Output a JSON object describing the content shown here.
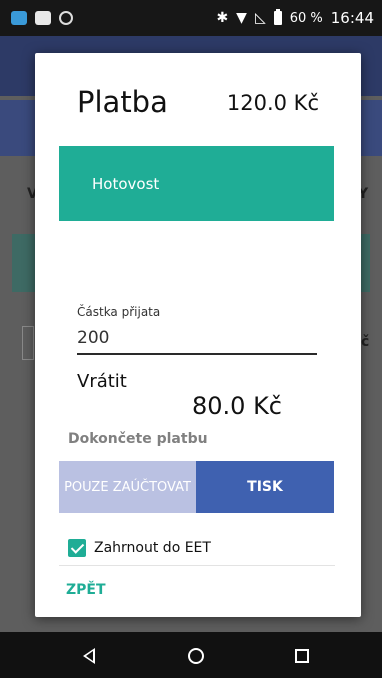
{
  "status_bar": {
    "battery": "60 %",
    "time": "16:44"
  },
  "background": {
    "left_letter": "V",
    "right_letter": "Y",
    "field_letter": "č"
  },
  "dialog": {
    "title": "Platba",
    "total": "120.0 Kč",
    "method_label": "Hotovost",
    "received_label": "Částka přijata",
    "received_value": "200",
    "change_label": "Vrátit",
    "change_amount": "80.0 Kč",
    "finish_label": "Dokončete platbu",
    "post_only_label": "POUZE ZAÚČTOVAT",
    "print_label": "TISK",
    "eet_label": "Zahrnout do EET",
    "eet_checked": true,
    "back_label": "ZPĚT"
  },
  "colors": {
    "accent_teal": "#1fad96",
    "primary_blue": "#3f61b0",
    "light_blue": "#bac1e2"
  }
}
